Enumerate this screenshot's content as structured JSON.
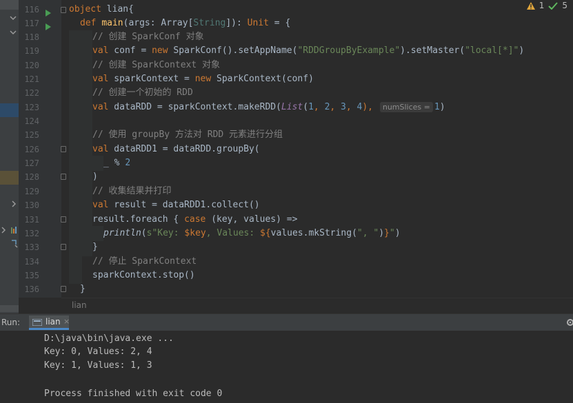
{
  "editor": {
    "lines": [
      {
        "n": "116",
        "text": "object lian{"
      },
      {
        "n": "117",
        "text": "def main(args: Array[String]): Unit = {"
      },
      {
        "n": "118",
        "text": "// 创建 SparkConf 对象"
      },
      {
        "n": "119",
        "text": "val conf = new SparkConf().setAppName(\"RDDGroupByExample\").setMaster(\"local[*]\")"
      },
      {
        "n": "120",
        "text": "// 创建 SparkContext 对象"
      },
      {
        "n": "121",
        "text": "val sparkContext = new SparkContext(conf)"
      },
      {
        "n": "122",
        "text": "// 创建一个初始的 RDD"
      },
      {
        "n": "123",
        "text": "val dataRDD = sparkContext.makeRDD(List(1, 2, 3, 4),  numSlices = 1)"
      },
      {
        "n": "124",
        "text": ""
      },
      {
        "n": "125",
        "text": "// 使用 groupBy 方法对 RDD 元素进行分组"
      },
      {
        "n": "126",
        "text": "val dataRDD1 = dataRDD.groupBy("
      },
      {
        "n": "127",
        "text": "_ % 2"
      },
      {
        "n": "128",
        "text": ")"
      },
      {
        "n": "129",
        "text": "// 收集结果并打印"
      },
      {
        "n": "130",
        "text": "val result = dataRDD1.collect()"
      },
      {
        "n": "131",
        "text": "result.foreach { case (key, values) =>"
      },
      {
        "n": "132",
        "text": "println(s\"Key: $key, Values: ${values.mkString(\", \")}\")"
      },
      {
        "n": "133",
        "text": "}"
      },
      {
        "n": "134",
        "text": "// 停止 SparkContext"
      },
      {
        "n": "135",
        "text": "sparkContext.stop()"
      },
      {
        "n": "136",
        "text": "}"
      }
    ],
    "tokens": {
      "l116_kw": "object",
      "l116_rest": " lian{",
      "l117_kw": "def ",
      "l117_fn": "main",
      "l117_a": "(args: ",
      "l117_arr": "Array",
      "l117_b": "[",
      "l117_str": "String",
      "l117_c": "]): ",
      "l117_unit": "Unit",
      "l117_d": " = {",
      "l118": "// 创建 SparkConf 对象",
      "l119_kw": "val",
      "l119_a": " conf = ",
      "l119_new": "new",
      "l119_b": " SparkConf().setAppName(",
      "l119_s1": "\"RDDGroupByExample\"",
      "l119_c": ").setMaster(",
      "l119_s2": "\"local[*]\"",
      "l119_d": ")",
      "l120": "// 创建 SparkContext 对象",
      "l121_kw": "val",
      "l121_a": " sparkContext = ",
      "l121_new": "new",
      "l121_b": " SparkContext(conf)",
      "l122": "// 创建一个初始的 RDD",
      "l123_kw": "val",
      "l123_a": " dataRDD = sparkContext.makeRDD(",
      "l123_list": "List",
      "l123_b": "(",
      "l123_n1": "1",
      "l123_c1": ", ",
      "l123_n2": "2",
      "l123_c2": ", ",
      "l123_n3": "3",
      "l123_c3": ", ",
      "l123_n4": "4",
      "l123_c4": "), ",
      "l123_hint": "numSlices =",
      "l123_n5": "1",
      "l123_d": ")",
      "l125": "// 使用 groupBy 方法对 RDD 元素进行分组",
      "l126_kw": "val",
      "l126_a": " dataRDD1 = dataRDD.groupBy(",
      "l127_a": "_ % ",
      "l127_n": "2",
      "l128": ")",
      "l129": "// 收集结果并打印",
      "l130_kw": "val",
      "l130_a": " result = dataRDD1.collect()",
      "l131_a": "result.foreach { ",
      "l131_kw": "case",
      "l131_b": " (key, values) =>",
      "l132_fn": "println",
      "l132_a": "(",
      "l132_s1": "s\"Key: ",
      "l132_v1": "$key",
      "l132_s2": ", Values: ",
      "l132_v2": "${",
      "l132_b": "values.mkString(",
      "l132_s3": "\", \"",
      "l132_c": ")",
      "l132_v3": "}",
      "l132_s4": "\"",
      "l132_d": ")",
      "l133": "}",
      "l134": "// 停止 SparkContext",
      "l135": "sparkContext.stop()",
      "l136": "}"
    }
  },
  "inspections": {
    "warnings": "1",
    "ok": "5"
  },
  "breadcrumb": "lian",
  "run": {
    "label": "Run:",
    "tab": "lian",
    "output": [
      "D:\\java\\bin\\java.exe ...",
      "Key: 0, Values: 2, 4",
      "Key: 1, Values: 1, 3",
      "",
      "Process finished with exit code 0"
    ]
  },
  "colors": {
    "keyword": "#cc7832",
    "string": "#6a8759",
    "number": "#6897bb",
    "comment": "#808080",
    "function": "#ffc66d"
  }
}
